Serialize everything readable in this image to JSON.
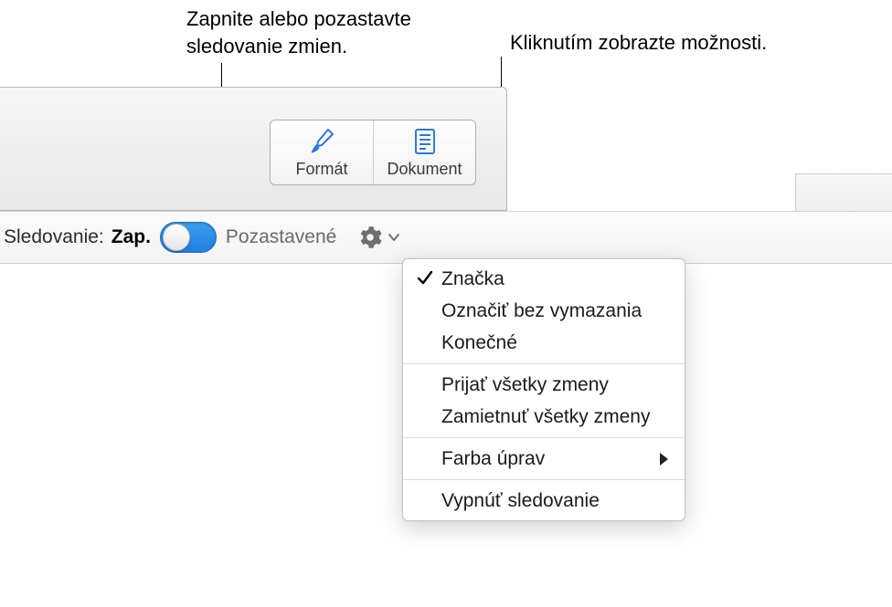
{
  "callouts": {
    "toggle": "Zapnite alebo pozastavte sledovanie zmien.",
    "options": "Kliknutím zobrazte možnosti."
  },
  "toolbar": {
    "format_label": "Formát",
    "document_label": "Dokument"
  },
  "tracking": {
    "label": "Sledovanie:",
    "on": "Zap.",
    "paused": "Pozastavené"
  },
  "menu": {
    "markup": "Značka",
    "markup_no_delete": "Označiť bez vymazania",
    "final": "Konečné",
    "accept_all": "Prijať všetky zmeny",
    "reject_all": "Zamietnuť všetky zmeny",
    "author_color": "Farba úprav",
    "turn_off": "Vypnúť sledovanie"
  },
  "icons": {
    "format": "format-paintbrush-icon",
    "document": "document-page-icon",
    "gear": "gear-icon",
    "chevron_down": "chevron-down-icon",
    "checkmark": "checkmark-icon",
    "submenu_arrow": "submenu-arrow-icon"
  }
}
